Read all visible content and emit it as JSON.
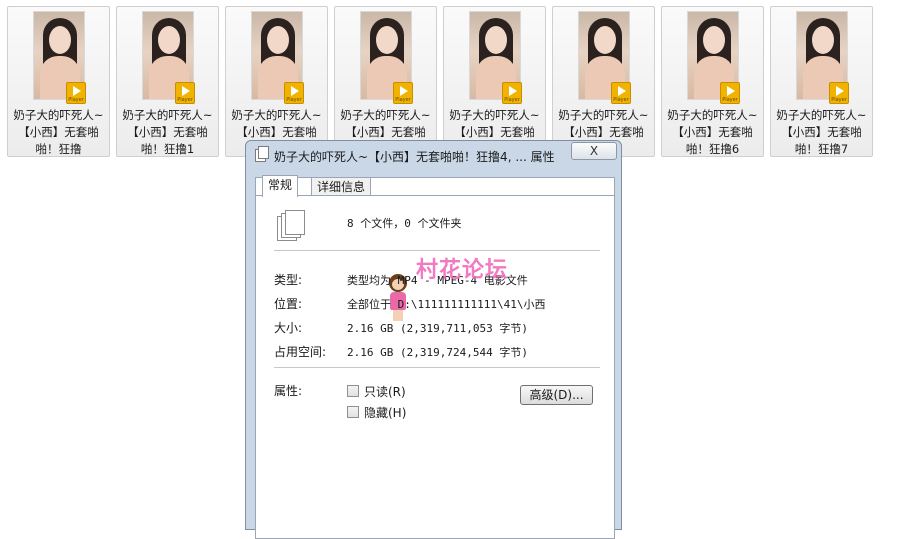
{
  "files": [
    {
      "caption": "奶子大的吓死人~\n【小西】无套啪\n啪！狂撸",
      "badge": "Player"
    },
    {
      "caption": "奶子大的吓死人~\n【小西】无套啪\n啪！狂撸1",
      "badge": "Player"
    },
    {
      "caption": "奶子大的吓死人~\n【小西】无套啪",
      "badge": "Player"
    },
    {
      "caption": "奶子大的吓死人~\n【小西】无套啪",
      "badge": "Player"
    },
    {
      "caption": "奶子大的吓死人~\n【小西】无套啪",
      "badge": "Player"
    },
    {
      "caption": "奶子大的吓死人~\n【小西】无套啪\n5",
      "badge": "Player"
    },
    {
      "caption": "奶子大的吓死人~\n【小西】无套啪\n啪！狂撸6",
      "badge": "Player"
    },
    {
      "caption": "奶子大的吓死人~\n【小西】无套啪\n啪！狂撸7",
      "badge": "Player"
    }
  ],
  "dialog": {
    "title": "奶子大的吓死人~【小西】无套啪啪！狂撸4, ... 属性",
    "close_glyph": "X",
    "tabs": [
      "常规",
      "详细信息"
    ],
    "summary": "8 个文件，0 个文件夹",
    "rows": [
      {
        "label": "类型:",
        "value": "类型均为 MP4 - MPEG-4 电影文件"
      },
      {
        "label": "位置:",
        "value": "全部位于 D:\\111111111111\\41\\小西"
      },
      {
        "label": "大小:",
        "value": "2.16 GB (2,319,711,053 字节)"
      },
      {
        "label": "占用空间:",
        "value": "2.16 GB (2,319,724,544 字节)"
      }
    ],
    "attributes_label": "属性:",
    "readonly_label": "只读(R)",
    "hidden_label": "隐藏(H)",
    "advanced_label": "高级(D)...",
    "watermark": "村花论坛"
  }
}
